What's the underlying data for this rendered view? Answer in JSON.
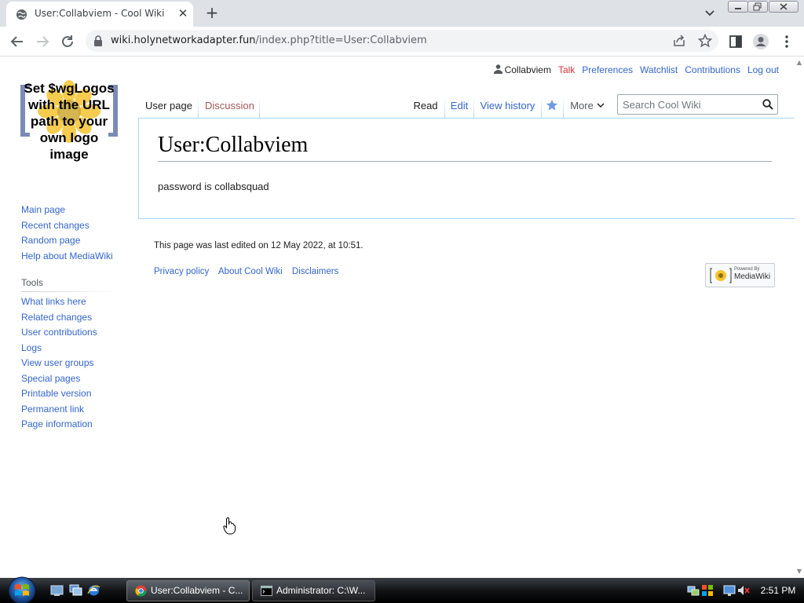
{
  "browser": {
    "tab_title": "User:Collabviem - Cool Wiki",
    "new_tab": "+",
    "close": "✕",
    "url_host": "wiki.holynetworkadapter.fun",
    "url_path": "/index.php?title=User:Collabviem"
  },
  "personal_tools": {
    "username": "Collabviem",
    "talk": "Talk",
    "preferences": "Preferences",
    "watchlist": "Watchlist",
    "contributions": "Contributions",
    "logout": "Log out"
  },
  "logo_text": "Set $wgLogos\nwith the URL\npath to your\nown logo\nimage",
  "page_tabs": {
    "user_page": "User page",
    "discussion": "Discussion",
    "read": "Read",
    "edit": "Edit",
    "view_history": "View history",
    "more": "More"
  },
  "search": {
    "placeholder": "Search Cool Wiki"
  },
  "article": {
    "title": "User:Collabviem",
    "body": "password is collabsquad"
  },
  "footer": {
    "last_edited": "This page was last edited on 12 May 2022, at 10:51.",
    "privacy": "Privacy policy",
    "about": "About Cool Wiki",
    "disclaimers": "Disclaimers",
    "powered_small": "Powered By",
    "powered_big": "MediaWiki"
  },
  "sidebar": {
    "nav": [
      "Main page",
      "Recent changes",
      "Random page",
      "Help about MediaWiki"
    ],
    "tools_heading": "Tools",
    "tools": [
      "What links here",
      "Related changes",
      "User contributions",
      "Logs",
      "View user groups",
      "Special pages",
      "Printable version",
      "Permanent link",
      "Page information"
    ]
  },
  "taskbar": {
    "chrome_task": "User:Collabviem - C...",
    "cmd_task": "Administrator: C:\\W...",
    "clock": "2:51 PM"
  },
  "colors": {
    "link": "#3366cc",
    "new_link": "#dd3333",
    "border": "#a7d7f9"
  }
}
